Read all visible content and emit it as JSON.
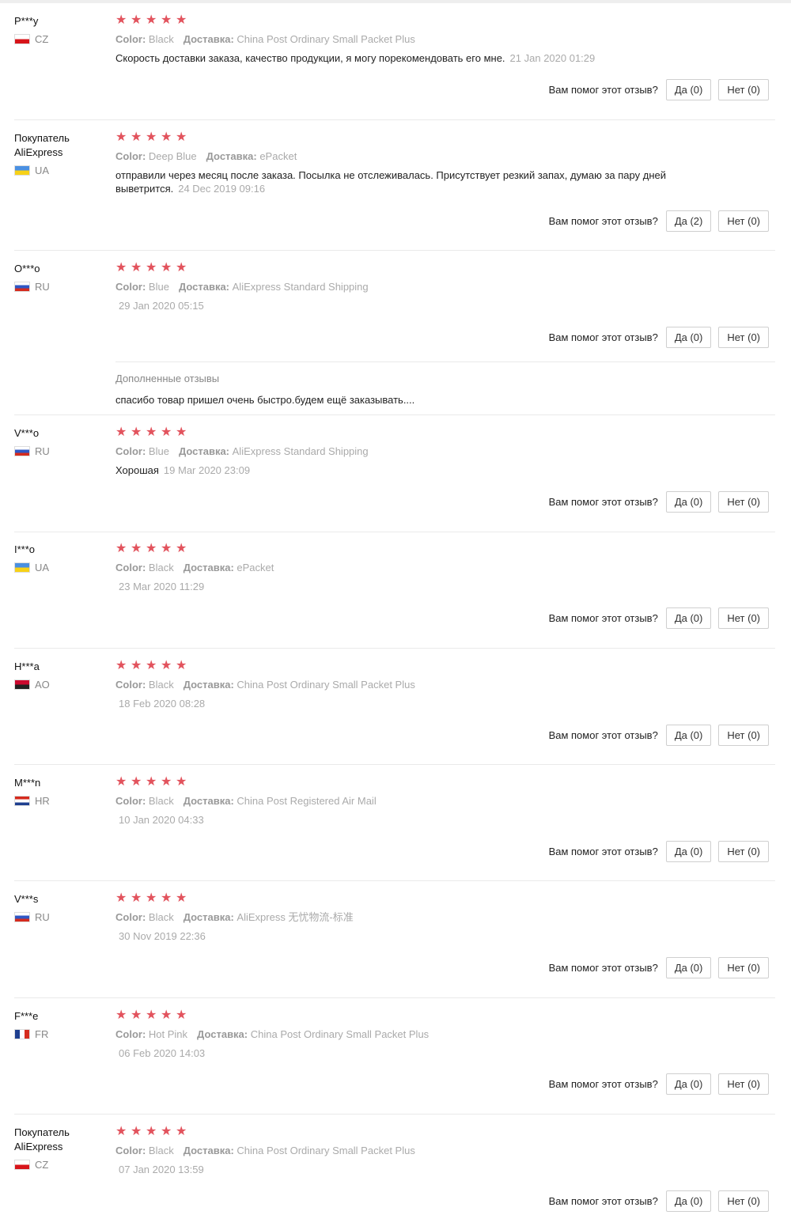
{
  "ui": {
    "helpful_question": "Вам помог этот отзыв?",
    "yes_prefix": "Да",
    "no_prefix": "Нет",
    "color_label": "Color:",
    "shipping_label": "Доставка:",
    "additional_reviews_label": "Дополненные отзывы"
  },
  "colors": {
    "star": "#e2535d",
    "muted": "#999999"
  },
  "reviews": [
    {
      "user": "P***y",
      "country": "CZ",
      "rating": 5,
      "color": "Black",
      "shipping": "China Post Ordinary Small Packet Plus",
      "text": "Скорость доставки заказа, качество продукции, я могу порекомендовать его мне.",
      "date": "21 Jan 2020 01:29",
      "yes": "Да (0)",
      "no": "Нет (0)"
    },
    {
      "user": "Покупатель AliExpress",
      "country": "UA",
      "rating": 5,
      "color": "Deep Blue",
      "shipping": "ePacket",
      "text": "отправили через месяц после заказа. Посылка не отслеживалась. Присутствует резкий запах, думаю за пару дней выветрится.",
      "date": "24 Dec 2019 09:16",
      "yes": "Да (2)",
      "no": "Нет (0)"
    },
    {
      "user": "O***o",
      "country": "RU",
      "rating": 5,
      "color": "Blue",
      "shipping": "AliExpress Standard Shipping",
      "text": "",
      "date": "29 Jan 2020 05:15",
      "yes": "Да (0)",
      "no": "Нет (0)",
      "additional_text": "спасибо товар пришел очень быстро.будем ещё заказывать...."
    },
    {
      "user": "V***o",
      "country": "RU",
      "rating": 5,
      "color": "Blue",
      "shipping": "AliExpress Standard Shipping",
      "text": "Хорошая",
      "date": "19 Mar 2020 23:09",
      "yes": "Да (0)",
      "no": "Нет (0)"
    },
    {
      "user": "I***o",
      "country": "UA",
      "rating": 5,
      "color": "Black",
      "shipping": "ePacket",
      "text": "",
      "date": "23 Mar 2020 11:29",
      "yes": "Да (0)",
      "no": "Нет (0)"
    },
    {
      "user": "H***a",
      "country": "AO",
      "rating": 5,
      "color": "Black",
      "shipping": "China Post Ordinary Small Packet Plus",
      "text": "",
      "date": "18 Feb 2020 08:28",
      "yes": "Да (0)",
      "no": "Нет (0)"
    },
    {
      "user": "M***n",
      "country": "HR",
      "rating": 5,
      "color": "Black",
      "shipping": "China Post Registered Air Mail",
      "text": "",
      "date": "10 Jan 2020 04:33",
      "yes": "Да (0)",
      "no": "Нет (0)"
    },
    {
      "user": "V***s",
      "country": "RU",
      "rating": 5,
      "color": "Black",
      "shipping": "AliExpress 无忧物流-标准",
      "text": "",
      "date": "30 Nov 2019 22:36",
      "yes": "Да (0)",
      "no": "Нет (0)"
    },
    {
      "user": "F***e",
      "country": "FR",
      "rating": 5,
      "color": "Hot Pink",
      "shipping": "China Post Ordinary Small Packet Plus",
      "text": "",
      "date": "06 Feb 2020 14:03",
      "yes": "Да (0)",
      "no": "Нет (0)"
    },
    {
      "user": "Покупатель AliExpress",
      "country": "CZ",
      "rating": 5,
      "color": "Black",
      "shipping": "China Post Ordinary Small Packet Plus",
      "text": "",
      "date": "07 Jan 2020 13:59",
      "yes": "Да (0)",
      "no": "Нет (0)"
    }
  ]
}
